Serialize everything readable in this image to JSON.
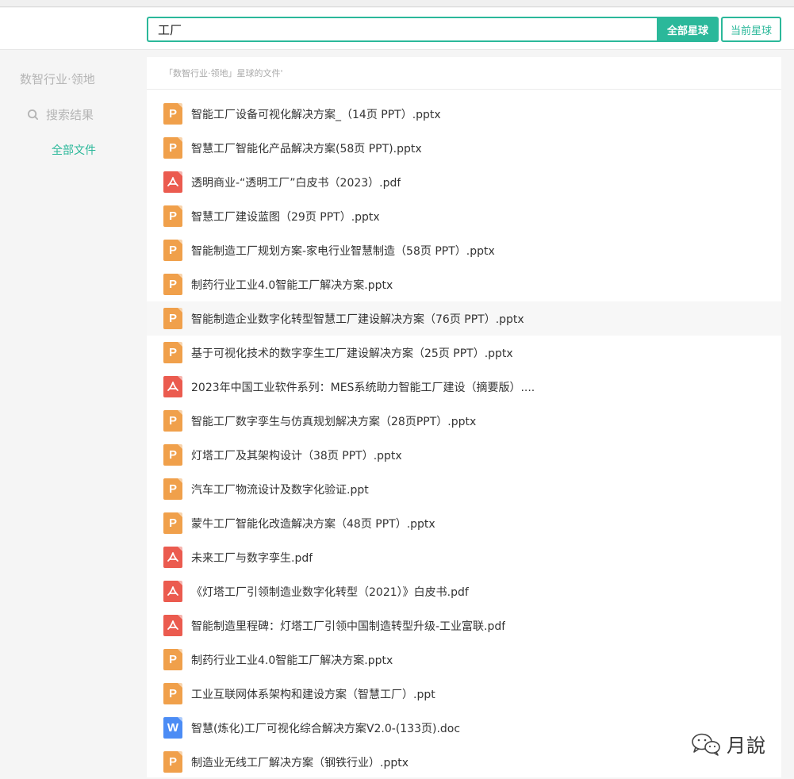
{
  "search": {
    "value": "工厂",
    "all_label": "全部星球",
    "current_label": "当前星球"
  },
  "sidebar": {
    "title": "数智行业·领地",
    "search_results_label": "搜索结果",
    "all_files_label": "全部文件"
  },
  "main": {
    "header": "「数智行业·领地」星球的文件'",
    "files": [
      {
        "name": "智能工厂设备可视化解决方案_（14页 PPT）.pptx",
        "type": "pptx",
        "icon": "ppt-file-icon"
      },
      {
        "name": "智慧工厂智能化产品解决方案(58页 PPT).pptx",
        "type": "pptx",
        "icon": "ppt-file-icon"
      },
      {
        "name": "透明商业-“透明工厂”白皮书（2023）.pdf",
        "type": "pdf",
        "icon": "pdf-file-icon"
      },
      {
        "name": "智慧工厂建设蓝图（29页 PPT）.pptx",
        "type": "pptx",
        "icon": "ppt-file-icon"
      },
      {
        "name": "智能制造工厂规划方案-家电行业智慧制造（58页 PPT）.pptx",
        "type": "pptx",
        "icon": "ppt-file-icon"
      },
      {
        "name": "制药行业工业4.0智能工厂解决方案.pptx",
        "type": "pptx",
        "icon": "ppt-file-icon"
      },
      {
        "name": "智能制造企业数字化转型智慧工厂建设解决方案（76页 PPT）.pptx",
        "type": "pptx",
        "icon": "ppt-file-icon"
      },
      {
        "name": "基于可视化技术的数字孪生工厂建设解决方案（25页 PPT）.pptx",
        "type": "pptx",
        "icon": "ppt-file-icon"
      },
      {
        "name": "2023年中国工业软件系列：MES系统助力智能工厂建设（摘要版）....",
        "type": "pdf",
        "icon": "pdf-file-icon"
      },
      {
        "name": "智能工厂数字孪生与仿真规划解决方案（28页PPT）.pptx",
        "type": "pptx",
        "icon": "ppt-file-icon"
      },
      {
        "name": "灯塔工厂及其架构设计（38页 PPT）.pptx",
        "type": "pptx",
        "icon": "ppt-file-icon"
      },
      {
        "name": "汽车工厂物流设计及数字化验证.ppt",
        "type": "ppt",
        "icon": "ppt-file-icon"
      },
      {
        "name": "蒙牛工厂智能化改造解决方案（48页 PPT）.pptx",
        "type": "pptx",
        "icon": "ppt-file-icon"
      },
      {
        "name": "未来工厂与数字孪生.pdf",
        "type": "pdf",
        "icon": "pdf-file-icon"
      },
      {
        "name": "《灯塔工厂引领制造业数字化转型（2021）》白皮书.pdf",
        "type": "pdf",
        "icon": "pdf-file-icon"
      },
      {
        "name": "智能制造里程碑：灯塔工厂引领中国制造转型升级-工业富联.pdf",
        "type": "pdf",
        "icon": "pdf-file-icon"
      },
      {
        "name": "制药行业工业4.0智能工厂解决方案.pptx",
        "type": "pptx",
        "icon": "ppt-file-icon"
      },
      {
        "name": "工业互联网体系架构和建设方案（智慧工厂）.ppt",
        "type": "ppt",
        "icon": "ppt-file-icon"
      },
      {
        "name": "智慧(炼化)工厂可视化综合解决方案V2.0-(133页).doc",
        "type": "doc",
        "icon": "word-file-icon"
      },
      {
        "name": "制造业无线工厂解决方案（钢铁行业）.pptx",
        "type": "pptx",
        "icon": "ppt-file-icon"
      }
    ]
  },
  "watermark": {
    "text": "月說",
    "icon": "wechat-icon"
  },
  "colors": {
    "accent": "#2bb89a",
    "ppt": "#f0a04b",
    "pdf": "#eb5b4f",
    "doc": "#4b8cf5"
  }
}
